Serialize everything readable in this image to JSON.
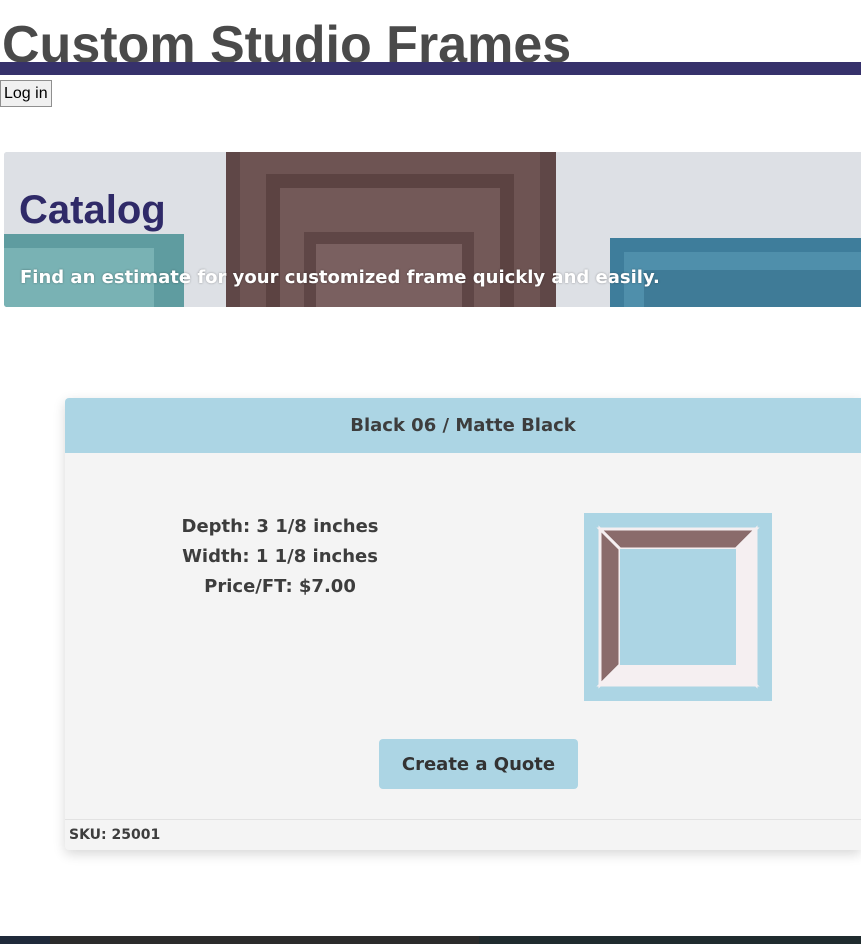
{
  "site": {
    "title": "Custom Studio Frames"
  },
  "header": {
    "login_label": "Log in"
  },
  "banner": {
    "heading": "Catalog",
    "subtitle": "Find an estimate for your customized frame quickly and easily."
  },
  "product": {
    "title": "Black 06 / Matte Black",
    "depth": "Depth: 3 1/8 inches",
    "width": "Width: 1 1/8 inches",
    "price": "Price/FT: $7.00",
    "quote_label": "Create a Quote",
    "sku": "SKU: 25001"
  },
  "colors": {
    "brand_dark": "#36316b",
    "accent_light_blue": "#acd5e4",
    "frame_brown": "#8a6b6b",
    "card_bg": "#f4f4f4"
  }
}
